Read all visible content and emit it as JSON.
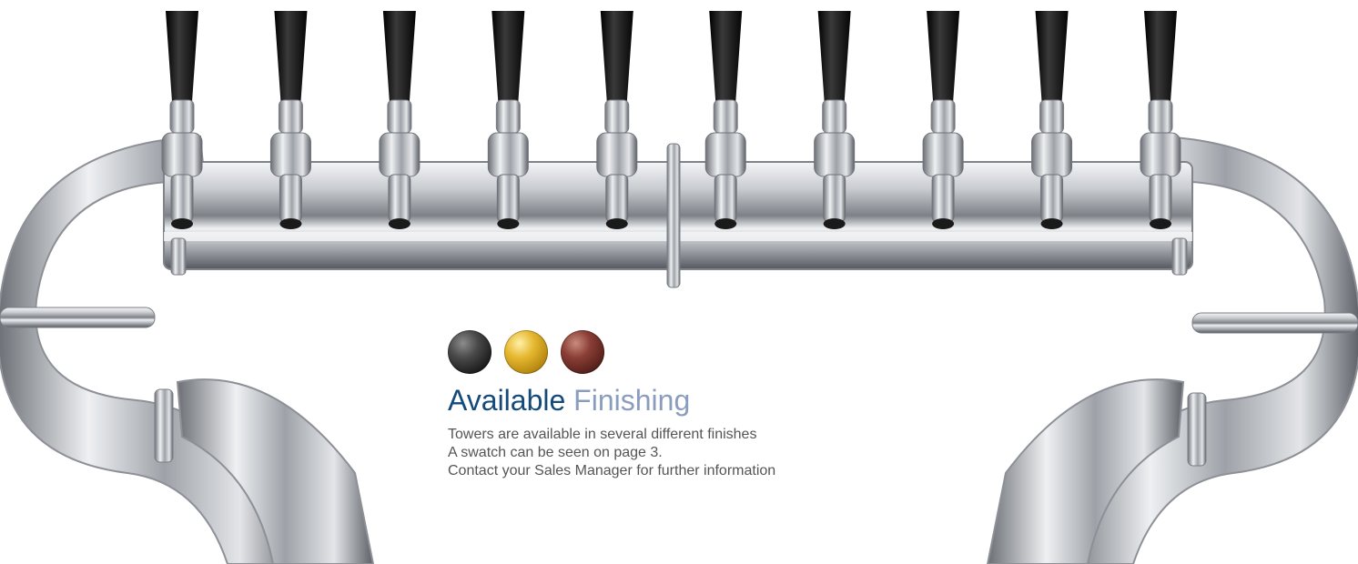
{
  "finishes": {
    "swatches": [
      {
        "name": "black",
        "color": "#1e1e1e"
      },
      {
        "name": "gold",
        "color": "#d4a32a"
      },
      {
        "name": "copper",
        "color": "#6a2a24"
      }
    ],
    "heading_strong": "Available",
    "heading_light": "Finishing",
    "heading_colors": {
      "strong": "#134a7a",
      "light": "#8a9dbf"
    },
    "lines": [
      "Towers are available in several different finishes",
      "A swatch can be seen on page 3.",
      "Contact your Sales Manager for further information"
    ]
  },
  "illustration": {
    "subject": "stainless steel beer tower with tap handles",
    "tap_count": 10,
    "handle_color": "#111111",
    "steel_color": "#c9ccd0"
  }
}
